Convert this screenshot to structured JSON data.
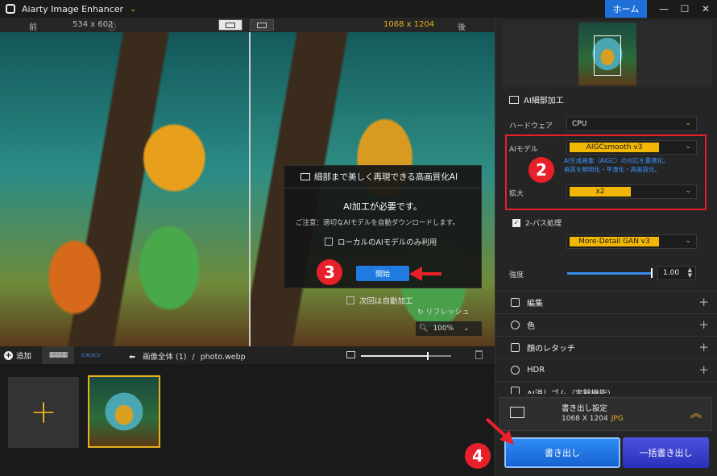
{
  "titlebar": {
    "app_title": "Aiarty Image Enhancer",
    "home_label": "ホーム"
  },
  "compare": {
    "before_label": "前",
    "before_size": "534 x 602",
    "after_size": "1068 x 1204",
    "after_label": "後"
  },
  "dialog": {
    "title": "細部まで美しく再現できる高画質化AI",
    "need_ai": "AI加工が必要です。",
    "note": "ご注意：適切なAIモデルを自動ダウンロードします。",
    "local_only": "ローカルのAIモデルのみ利用",
    "start_label": "開始"
  },
  "overlay": {
    "auto_next": "次回は自動加工",
    "refresh": "リフレッシュ",
    "zoom": "100%"
  },
  "toolbar": {
    "add_label": "追加",
    "crumb_all": "画像全体 (1)",
    "crumb_sep": "/",
    "crumb_file": "photo.webp"
  },
  "panel": {
    "section_title": "AI細部加工",
    "hardware_label": "ハードウェア",
    "hardware_value": "CPU",
    "model_label": "AIモデル",
    "model_value": "AIGCsmooth  v3",
    "model_desc_1": "AI生成画像（AIGC）の対応を最適化。",
    "model_desc_2": "画質を鮮明化・平滑化・高画質化。",
    "scale_label": "拡大",
    "scale_value": "x2",
    "twopass_label": "2-パス処理",
    "twopass_model": "More-Detail GAN  v3",
    "strength_label": "強度",
    "strength_value": "1.00",
    "strength_fraction": 1.0
  },
  "accordions": [
    "編集",
    "色",
    "顔のレタッチ",
    "HDR",
    "AI消しゴム（実験機能）"
  ],
  "export": {
    "settings_title": "書き出し設定",
    "settings_size": "1068 X 1204",
    "settings_format": "JPG",
    "export_label": "書き出し",
    "batch_label": "一括書き出し"
  },
  "badges": [
    "2",
    "3",
    "4"
  ],
  "colors": {
    "accent": "#f2b705",
    "primary": "#1f7be0",
    "annotation": "#e8202a"
  }
}
